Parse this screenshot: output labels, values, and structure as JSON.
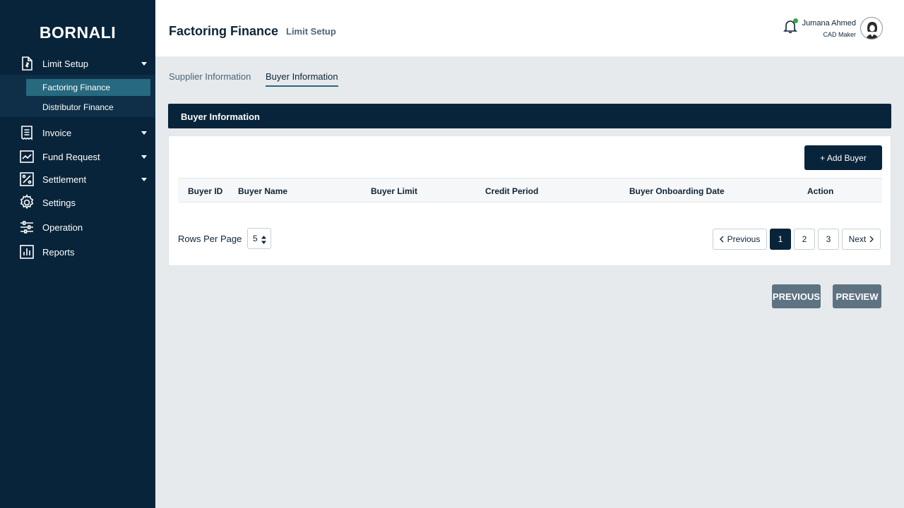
{
  "sidebar": {
    "brand": "BORNALI",
    "items": [
      {
        "label": "Limit Setup",
        "icon": "file-money-icon"
      },
      {
        "label": "Invoice",
        "icon": "receipt-icon"
      },
      {
        "label": "Fund Request",
        "icon": "chart-up-icon"
      },
      {
        "label": "Settlement",
        "icon": "percent-icon"
      },
      {
        "label": "Settings",
        "icon": "gear-icon"
      },
      {
        "label": "Operation",
        "icon": "sliders-icon"
      },
      {
        "label": "Reports",
        "icon": "bar-chart-icon"
      }
    ],
    "sub_items": [
      {
        "label": "Factoring Finance",
        "active": true
      },
      {
        "label": "Distributor Finance",
        "active": false
      }
    ]
  },
  "header": {
    "title": "Factoring Finance",
    "subtitle": "Limit Setup",
    "user_name": "Jumana Ahmed",
    "user_role": "CAD Maker",
    "notification_status_color": "#2eaa44"
  },
  "tabs": [
    {
      "label": "Supplier Information",
      "active": false
    },
    {
      "label": "Buyer Information",
      "active": true
    }
  ],
  "section": {
    "title": "Buyer Information",
    "add_button": "+ Add Buyer",
    "columns": [
      "Buyer ID",
      "Buyer Name",
      "Buyer Limit",
      "Credit Period",
      "Buyer Onboarding Date",
      "Action"
    ],
    "rows": []
  },
  "pagination": {
    "rows_per_page_label": "Rows Per Page",
    "rows_per_page": "5",
    "previous": "Previous",
    "next": "Next",
    "pages": [
      "1",
      "2",
      "3"
    ],
    "current_page": "1"
  },
  "actions": {
    "previous": "PREVIOUS",
    "preview": "PREVIEW"
  },
  "colors": {
    "sidebar_bg": "#08243a",
    "active_sub_item": "#27697f",
    "content_bg": "#e6eaed",
    "action_button": "#5e7382"
  }
}
